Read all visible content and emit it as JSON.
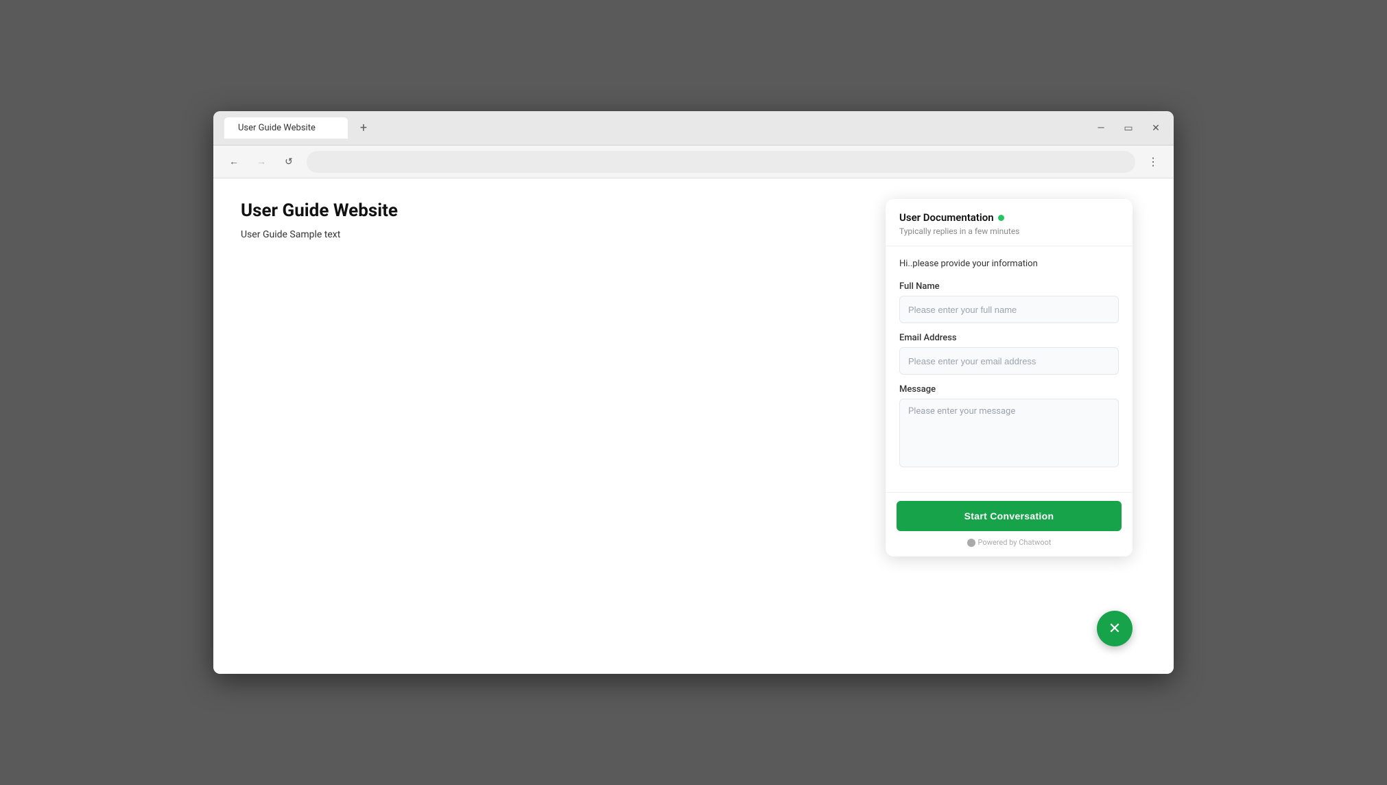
{
  "browser": {
    "tab_label": "User Guide Website",
    "add_tab_icon": "+",
    "address_bar_value": "",
    "menu_icon": "⋮",
    "back_icon": "←",
    "forward_icon": "→",
    "reload_icon": "↺",
    "minimize_icon": "—",
    "maximize_icon": "▭",
    "close_icon": "✕"
  },
  "page": {
    "title": "User Guide Website",
    "subtitle": "User Guide Sample text"
  },
  "chat_widget": {
    "header": {
      "title": "User Documentation",
      "online_status": "online",
      "subtitle": "Typically replies in a few minutes"
    },
    "body": {
      "intro": "Hi..please provide your information",
      "full_name_label": "Full Name",
      "full_name_placeholder": "Please enter your full name",
      "email_label": "Email Address",
      "email_placeholder": "Please enter your email address",
      "message_label": "Message",
      "message_placeholder": "Please enter your message"
    },
    "footer": {
      "start_button_label": "Start Conversation",
      "powered_by_text": "Powered by Chatwoot"
    }
  },
  "floating_button": {
    "icon": "✕",
    "label": "close chat"
  }
}
